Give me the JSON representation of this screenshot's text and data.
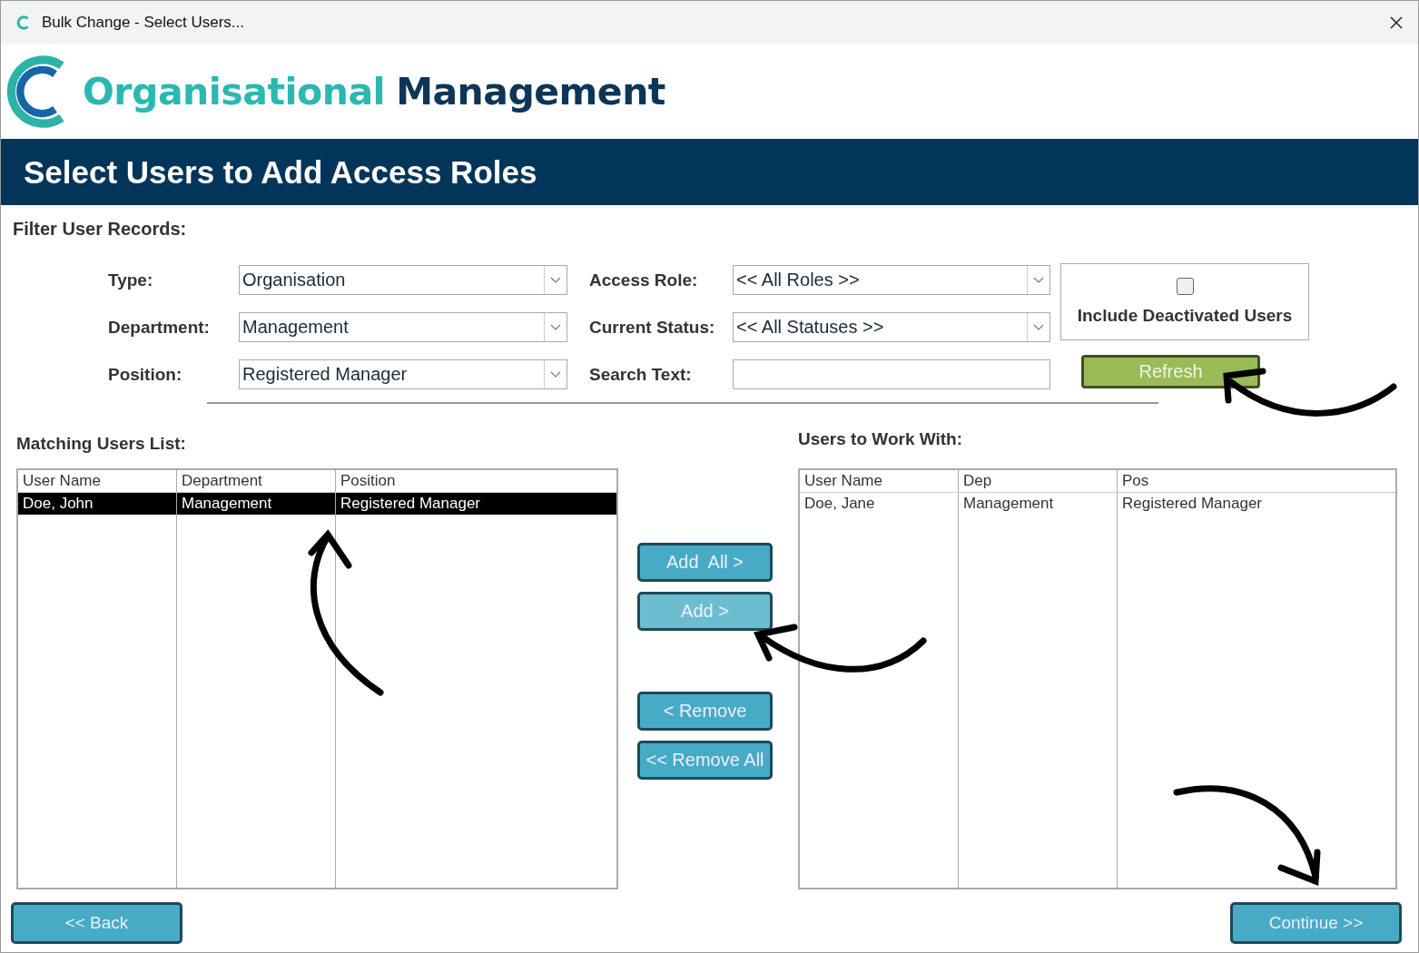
{
  "window": {
    "title": "Bulk Change - Select Users..."
  },
  "logo": {
    "word_1": "Organisational",
    "word_2": "Management"
  },
  "header": {
    "title": "Select Users to Add Access Roles"
  },
  "filter": {
    "title": "Filter User Records:",
    "fields": [
      {
        "label": "Type:",
        "kind": "dropdown",
        "value": "Organisation"
      },
      {
        "label": "Access Role:",
        "kind": "dropdown",
        "value": "<< All Roles >>"
      },
      {
        "label": "Department:",
        "kind": "dropdown",
        "value": "Management"
      },
      {
        "label": "Current Status:",
        "kind": "dropdown",
        "value": "<< All Statuses >>"
      },
      {
        "label": "Position:",
        "kind": "dropdown",
        "value": "Registered Manager"
      },
      {
        "label": "Search Text:",
        "kind": "text"
      }
    ],
    "include_deactivated": {
      "label": "Include Deactivated Users",
      "checked": false
    },
    "refresh_button": "Refresh"
  },
  "matching_list": {
    "title": "Matching Users List:",
    "columns": [
      "User Name",
      "Department",
      "Position"
    ],
    "rows": [
      {
        "cells": [
          "Doe, John",
          "Management",
          "Registered Manager"
        ],
        "selected": true
      }
    ]
  },
  "move_buttons": [
    {
      "label": "Add  All >",
      "highlighted": false
    },
    {
      "label": "Add >",
      "highlighted": true
    },
    {
      "label": "< Remove",
      "highlighted": false
    },
    {
      "label": "<< Remove All",
      "highlighted": false
    }
  ],
  "work_list": {
    "title": "Users to Work With:",
    "columns": [
      "User Name",
      "Dep",
      "Pos"
    ],
    "rows": [
      {
        "cells": [
          "Doe, Jane",
          "Management",
          "Registered Manager"
        ],
        "selected": false
      }
    ]
  },
  "footer": {
    "back_button": "<< Back",
    "continue_button": "Continue >>"
  }
}
